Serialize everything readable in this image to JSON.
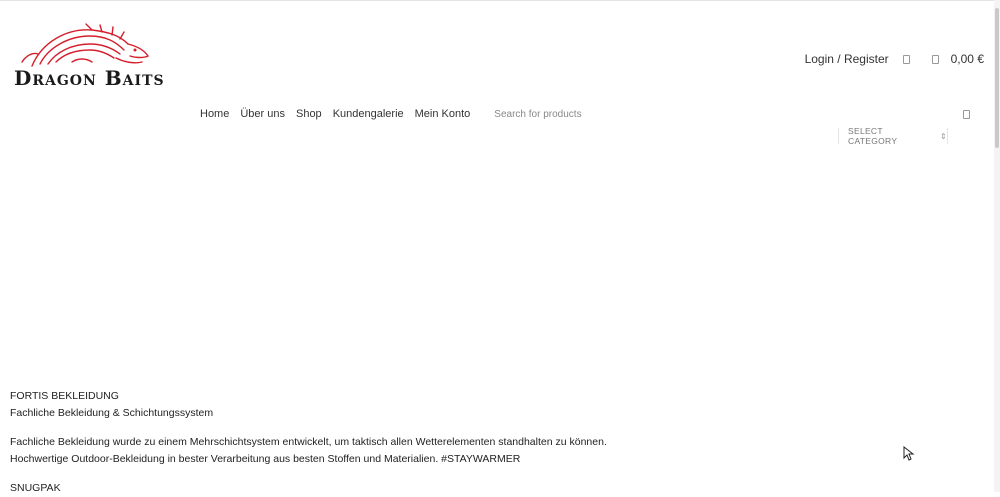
{
  "brand": {
    "logo_text": "Dragon Baits",
    "accent_color": "#d41f2c"
  },
  "header": {
    "login_label": "Login / Register",
    "cart_total": "0,00 €",
    "icons": [
      "compare-icon",
      "cart-icon"
    ]
  },
  "nav": {
    "items": [
      {
        "label": "Home"
      },
      {
        "label": "Über uns"
      },
      {
        "label": "Shop"
      },
      {
        "label": "Kundengalerie"
      },
      {
        "label": "Mein Konto"
      }
    ]
  },
  "search": {
    "placeholder": "Search for products",
    "category_label": "SELECT CATEGORY"
  },
  "content": {
    "heading": "FORTIS BEKLEIDUNG",
    "subheading": "Fachliche Bekleidung & Schichtungssystem",
    "paragraph_line1": "Fachliche Bekleidung wurde zu einem Mehrschichtsystem entwickelt, um taktisch allen Wetterelementen standhalten zu können.",
    "paragraph_line2": "Hochwertige Outdoor-Bekleidung in bester Verarbeitung aus besten Stoffen und Materialien. #STAYWARMER",
    "next_heading": "SNUGPAK"
  }
}
